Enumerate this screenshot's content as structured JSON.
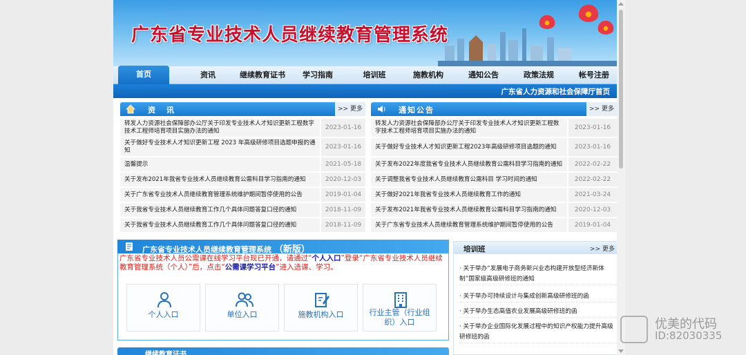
{
  "banner": {
    "title": "广东省专业技术人员继续教育管理系统"
  },
  "nav": {
    "items": [
      "首页",
      "资讯",
      "继续教育证书",
      "学习指南",
      "培训班",
      "施教机构",
      "通知公告",
      "政策法规",
      "帐号注册"
    ],
    "active": "首页"
  },
  "subnav": {
    "link": "广东省人力资源和社会保障厅首页"
  },
  "news": {
    "title": "资 讯",
    "more": ">> 更多",
    "rows": [
      {
        "text": "转发人力资源社会保障部办公厅关于印发专业技术人才知识更新工程数字技术工程师培育项目实施办法的通知",
        "date": "2023-01-16"
      },
      {
        "text": "关于做好专业技术人才知识更新工程 2023 年高级研修项目选题申报的通知",
        "date": "2023-01-16"
      },
      {
        "text": "温馨提示",
        "date": "2021-05-18"
      },
      {
        "text": "关于发布2021年我省专业技术人员继续教育公需科目学习指南的通知",
        "date": "2020-12-03"
      },
      {
        "text": "关于广东省专业技术人员继续教育管理系统维护期间暂停使用的公告",
        "date": "2019-01-04"
      },
      {
        "text": "关于我省专业技术人员继续教育工作几个具体问题答复口径的通知",
        "date": "2018-11-09"
      },
      {
        "text": "关于我省专业技术人员继续教育工作几个具体问题答复口径的通知",
        "date": "2018-11-09"
      }
    ]
  },
  "notices": {
    "title": "通知公告",
    "more": ">> 更多",
    "rows": [
      {
        "text": "转发人力资源社会保障部办公厅关于印发专业技术人才知识更新工程数字技术工程师培育项目实施办法的通知",
        "date": "2023-01-16"
      },
      {
        "text": "关于做好专业技术人才知识更新工程2023年高级研修项目选题的通知",
        "date": "2023-01-16"
      },
      {
        "text": "关于发布2022年度我省专业技术人员继续教育公需科目学习指南的通知",
        "date": "2022-02-22"
      },
      {
        "text": "关于调整我省专业技术人员继续教育公需科目 学习时间的通知",
        "date": "2022-02-22"
      },
      {
        "text": "关于做好2021年我省专业技术人员继续教育工作的通知",
        "date": "2021-03-24"
      },
      {
        "text": "关于发布2021年我省专业技术人员继续教育公需科目学习指南的通知",
        "date": "2020-12-03"
      },
      {
        "text": "关于广东省专业技术人员继续教育管理系统维护期间暂停使用的公告",
        "date": "2019-01-04"
      }
    ]
  },
  "system": {
    "title": "广东省专业技术人员继续教育管理系统",
    "badge": "（新版）",
    "notice_a": "广东省专业技术人员公需课在线学习平台现已开通，请通过“",
    "notice_b": "个人入口",
    "notice_c": "”登录“广东省专业技术人员继续教育管理系统（个人）”后，点击“",
    "notice_d": "公需课学习平台",
    "notice_e": "”进入选课、学习。",
    "entries": [
      "个人入口",
      "单位入口",
      "施教机构入口",
      "行业主管（行业组织）入口"
    ]
  },
  "training": {
    "title": "培训班",
    "more": ">> 更多",
    "items": [
      "· 关于举办“发展电子商务新兴业态构建开放型经济新体制”国家级高级研修班的通知",
      "· 关于举办可持续设计与集成创新高级研修班的函",
      "· 关于举办生态高值农业发展高级研修班的函",
      "· 关于举办企业国际化发展过程中的知识产权能力提升高级研修班的函"
    ]
  },
  "bottom_section": {
    "title": "继续教育证书"
  },
  "watermark": {
    "line1": "优美的代码",
    "line2": "ID:82030335"
  },
  "colors": {
    "primary": "#1a79cf",
    "title_red": "#c8102e",
    "notice_red": "#e0201b",
    "entry_blue": "#2870b8"
  }
}
